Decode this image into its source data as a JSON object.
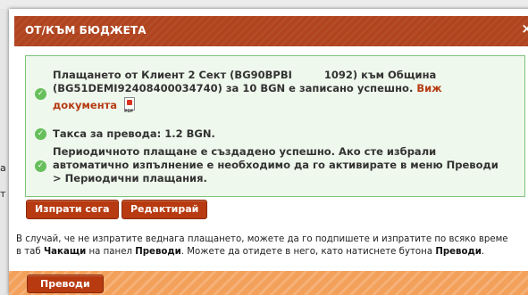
{
  "background": {
    "side_letters": [
      "а",
      "т"
    ]
  },
  "dialog": {
    "title": "ОТ/КЪМ БЮДЖЕТА",
    "close_label": "×",
    "messages": {
      "payment_line1": "Плащането от Клиент 2 Сект (BG90BPBI         1092) към Община",
      "payment_line2": "(BG51DEMI92408400034740) за 10 BGN е записано успешно.",
      "view_word": "Виж",
      "document_word": "документа",
      "pdf_label": "PDF",
      "fee": "Такса за превода: 1.2 BGN.",
      "periodic_line1": "Периодичното плащане е създадено успешно. Ако сте избрали",
      "periodic_line2": "автоматично изпълнение е необходимо да го активирате в меню Преводи",
      "periodic_line3": "> Периодични плащания."
    },
    "buttons": {
      "send_now": "Изпрати сега",
      "edit": "Редактирай",
      "transfers": "Преводи"
    },
    "info": {
      "line1": "В случай, че не изпратите веднага плащането, можете да го подпишете и изпратите по всяко време",
      "line2_part1": "в таб ",
      "line2_bold1": "Чакащи",
      "line2_part2": " на панел ",
      "line2_bold2": "Преводи",
      "line2_part3": ". Можете да отидете в него, като натиснете бутона ",
      "line2_bold3": "Преводи",
      "line2_part4": "."
    }
  },
  "icons": {
    "check": "check-circle-icon",
    "pdf": "pdf-file-icon",
    "close": "close-icon"
  },
  "colors": {
    "accent": "#b0441f",
    "button": "#b73a10",
    "success_border": "#7cc47c",
    "success_bg": "#eff8ec",
    "check": "#67bf5b",
    "bottom_bar": "#f3a05a"
  }
}
